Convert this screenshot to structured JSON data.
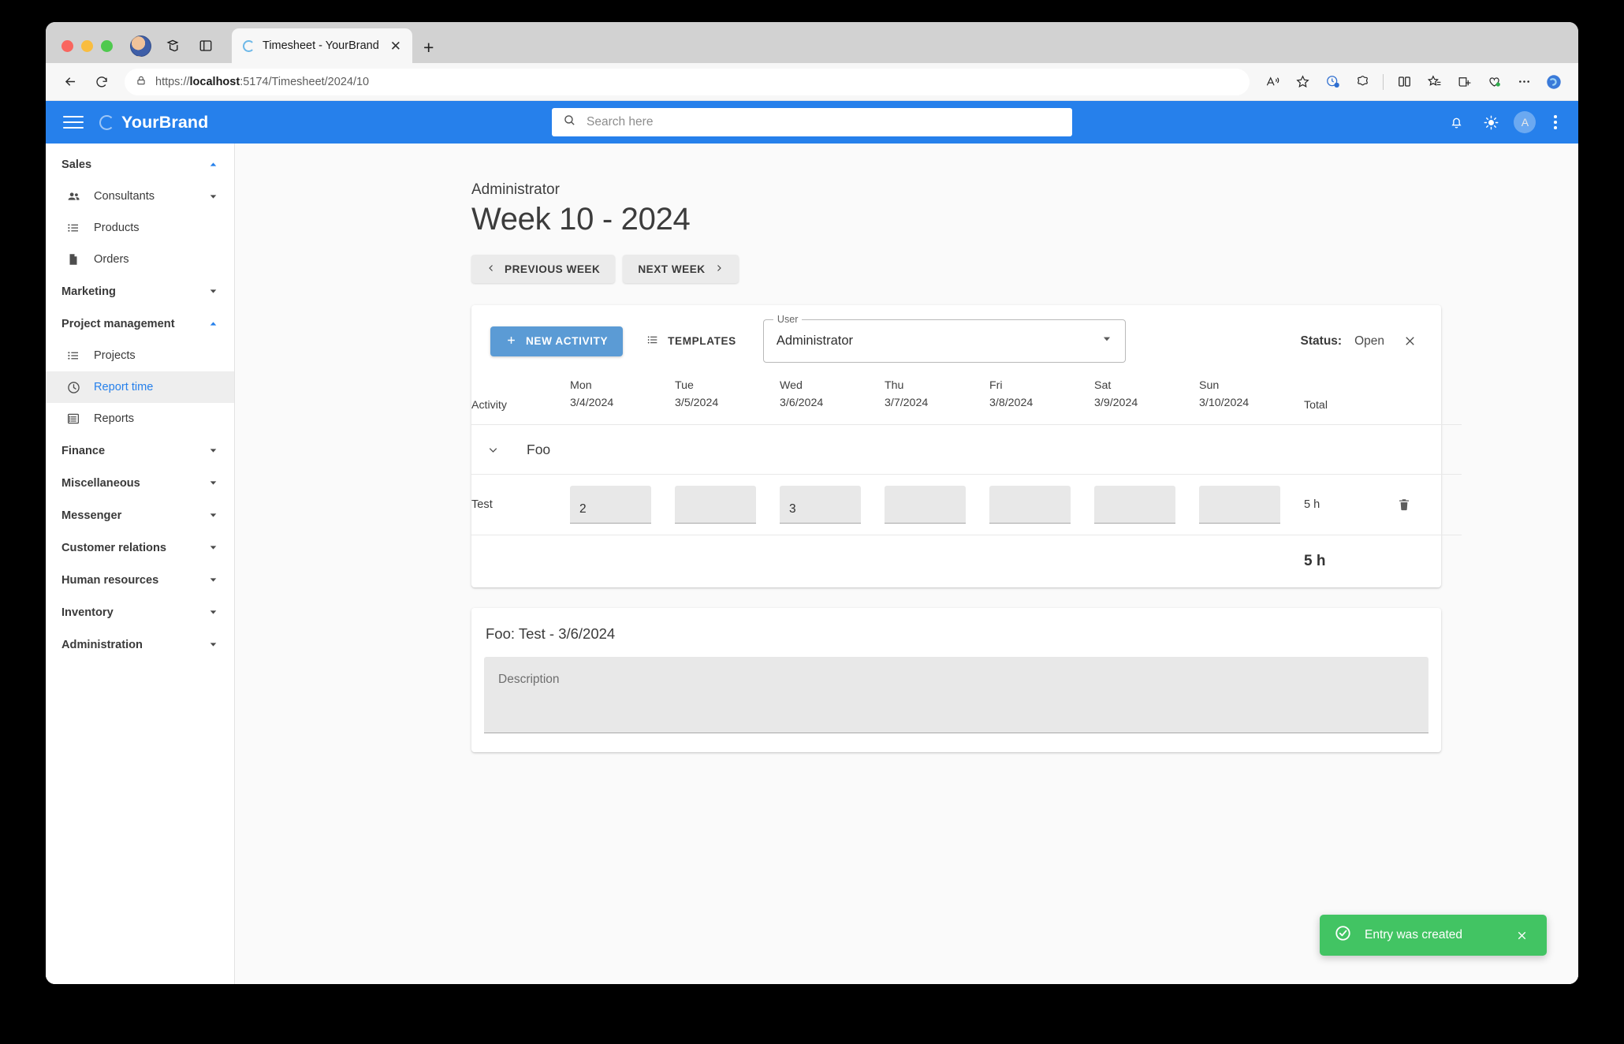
{
  "browser": {
    "tab": {
      "title": "Timesheet - YourBrand",
      "close_label": "✕",
      "favicon_name": "loading-ring-favicon"
    },
    "new_tab_label": "+",
    "url_prefix": "https://",
    "url_host": "localhost",
    "url_rest": ":5174/Timesheet/2024/10",
    "back_label": "←",
    "reload_label": "↻",
    "toolbar_icons": [
      "read-aloud-icon",
      "favorite-star-icon",
      "browser-essentials-icon",
      "copilot-icon",
      "split-screen-icon",
      "favorites-icon",
      "collections-icon",
      "performance-icon",
      "settings-more-icon",
      "copilot-sidebar-icon"
    ]
  },
  "appbar": {
    "brand": "YourBrand",
    "menu_label": "menu",
    "search_placeholder": "Search here",
    "avatar_initial": "A",
    "icons": [
      "notifications-bell-icon",
      "theme-sun-icon",
      "more-vertical-icon"
    ]
  },
  "sidebar": {
    "items": [
      {
        "label": "Sales",
        "type": "group",
        "expanded": true,
        "icon": ""
      },
      {
        "label": "Consultants",
        "type": "item",
        "icon": "people-icon",
        "has_caret": true
      },
      {
        "label": "Products",
        "type": "item",
        "icon": "list-icon",
        "has_caret": false
      },
      {
        "label": "Orders",
        "type": "item",
        "icon": "document-icon",
        "has_caret": false
      },
      {
        "label": "Marketing",
        "type": "group",
        "expanded": false,
        "icon": ""
      },
      {
        "label": "Project management",
        "type": "group",
        "expanded": true,
        "icon": ""
      },
      {
        "label": "Projects",
        "type": "item",
        "icon": "list-icon",
        "has_caret": false
      },
      {
        "label": "Report time",
        "type": "item",
        "icon": "clock-icon",
        "has_caret": false,
        "active": true
      },
      {
        "label": "Reports",
        "type": "item",
        "icon": "table-icon",
        "has_caret": false
      },
      {
        "label": "Finance",
        "type": "group",
        "expanded": false,
        "icon": ""
      },
      {
        "label": "Miscellaneous",
        "type": "group",
        "expanded": false,
        "icon": ""
      },
      {
        "label": "Messenger",
        "type": "group",
        "expanded": false,
        "icon": ""
      },
      {
        "label": "Customer relations",
        "type": "group",
        "expanded": false,
        "icon": ""
      },
      {
        "label": "Human resources",
        "type": "group",
        "expanded": false,
        "icon": ""
      },
      {
        "label": "Inventory",
        "type": "group",
        "expanded": false,
        "icon": ""
      },
      {
        "label": "Administration",
        "type": "group",
        "expanded": false,
        "icon": ""
      }
    ]
  },
  "page": {
    "subtitle": "Administrator",
    "title": "Week 10 - 2024",
    "previous_week": "PREVIOUS WEEK",
    "next_week": "NEXT WEEK"
  },
  "toolbar": {
    "new_activity": "NEW ACTIVITY",
    "templates": "TEMPLATES",
    "user_legend": "User",
    "user_value": "Administrator",
    "status_label": "Status:",
    "status_value": "Open",
    "close_label": "✕"
  },
  "timesheet": {
    "headers": {
      "activity": "Activity",
      "total": "Total",
      "days": [
        {
          "day": "Mon",
          "date": "3/4/2024"
        },
        {
          "day": "Tue",
          "date": "3/5/2024"
        },
        {
          "day": "Wed",
          "date": "3/6/2024"
        },
        {
          "day": "Thu",
          "date": "3/7/2024"
        },
        {
          "day": "Fri",
          "date": "3/8/2024"
        },
        {
          "day": "Sat",
          "date": "3/9/2024"
        },
        {
          "day": "Sun",
          "date": "3/10/2024"
        }
      ]
    },
    "group": {
      "name": "Foo",
      "expanded": true
    },
    "rows": [
      {
        "name": "Test",
        "values": [
          "2",
          "",
          "3",
          "",
          "",
          "",
          ""
        ],
        "total": "5 h",
        "delete_icon": "trash-icon"
      }
    ],
    "grand_total": "5 h"
  },
  "description_card": {
    "title": "Foo: Test - 3/6/2024",
    "field_placeholder": "Description",
    "field_value": ""
  },
  "toast": {
    "message": "Entry was created",
    "icon": "check-circle-icon",
    "close_label": "✕",
    "color": "#42c463"
  },
  "colors": {
    "accent": "#2680eb",
    "primary_button": "#5b9bd5",
    "success": "#42c463",
    "active_link": "#2680eb"
  }
}
